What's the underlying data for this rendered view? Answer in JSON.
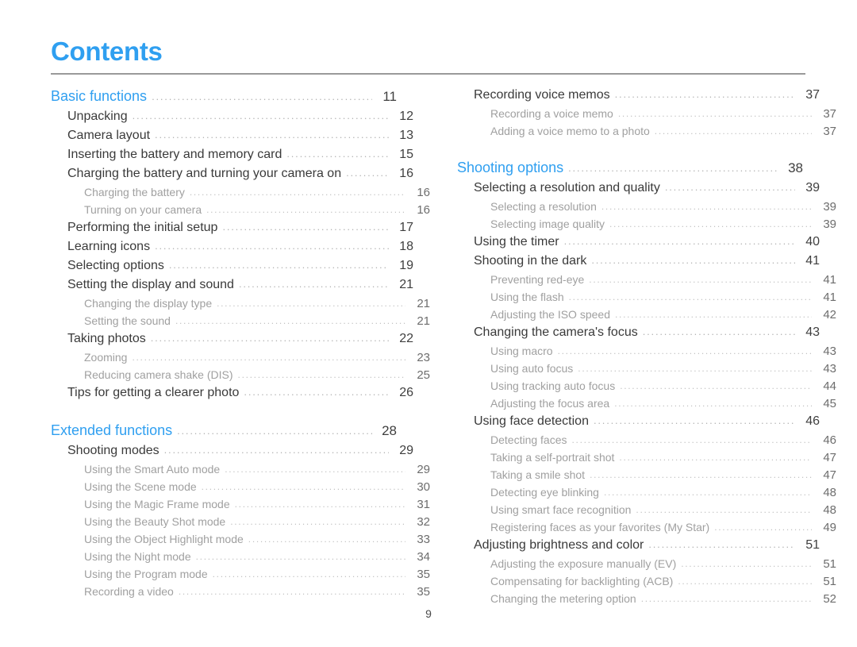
{
  "document": {
    "title": "Contents",
    "folio": "9",
    "accent_color": "#2f9ff0",
    "rule_color": "#9a9a9a"
  },
  "columns": {
    "left": {
      "groups": [
        {
          "entries": [
            {
              "level": 1,
              "label": "Basic functions",
              "page": "11"
            },
            {
              "level": 2,
              "label": "Unpacking",
              "page": "12"
            },
            {
              "level": 2,
              "label": "Camera layout",
              "page": "13"
            },
            {
              "level": 2,
              "label": "Inserting the battery and memory card",
              "page": "15"
            },
            {
              "level": 2,
              "label": "Charging the battery and turning your camera on",
              "page": "16"
            },
            {
              "level": 3,
              "label": "Charging the battery",
              "page": "16"
            },
            {
              "level": 3,
              "label": "Turning on your camera",
              "page": "16"
            },
            {
              "level": 2,
              "label": "Performing the initial setup",
              "page": "17"
            },
            {
              "level": 2,
              "label": "Learning icons",
              "page": "18"
            },
            {
              "level": 2,
              "label": "Selecting options",
              "page": "19"
            },
            {
              "level": 2,
              "label": "Setting the display and sound",
              "page": "21"
            },
            {
              "level": 3,
              "label": "Changing the display type",
              "page": "21"
            },
            {
              "level": 3,
              "label": "Setting the sound",
              "page": "21"
            },
            {
              "level": 2,
              "label": "Taking photos",
              "page": "22"
            },
            {
              "level": 3,
              "label": "Zooming",
              "page": "23"
            },
            {
              "level": 3,
              "label": "Reducing camera shake (DIS)",
              "page": "25"
            },
            {
              "level": 2,
              "label": "Tips for getting a clearer photo",
              "page": "26"
            }
          ]
        },
        {
          "entries": [
            {
              "level": 1,
              "label": "Extended functions",
              "page": "28"
            },
            {
              "level": 2,
              "label": "Shooting modes",
              "page": "29"
            },
            {
              "level": 3,
              "label": "Using the Smart Auto mode",
              "page": "29"
            },
            {
              "level": 3,
              "label": "Using the Scene mode",
              "page": "30"
            },
            {
              "level": 3,
              "label": "Using the Magic Frame mode",
              "page": "31"
            },
            {
              "level": 3,
              "label": "Using the Beauty Shot mode",
              "page": "32"
            },
            {
              "level": 3,
              "label": "Using the Object Highlight mode",
              "page": "33"
            },
            {
              "level": 3,
              "label": "Using the Night mode",
              "page": "34"
            },
            {
              "level": 3,
              "label": "Using the Program mode",
              "page": "35"
            },
            {
              "level": 3,
              "label": "Recording a video",
              "page": "35"
            }
          ]
        }
      ]
    },
    "right": {
      "groups": [
        {
          "entries": [
            {
              "level": 2,
              "label": "Recording voice memos",
              "page": "37"
            },
            {
              "level": 3,
              "label": "Recording a voice memo",
              "page": "37"
            },
            {
              "level": 3,
              "label": "Adding a voice memo to a photo",
              "page": "37"
            }
          ]
        },
        {
          "entries": [
            {
              "level": 1,
              "label": "Shooting options",
              "page": "38"
            },
            {
              "level": 2,
              "label": "Selecting a resolution and quality",
              "page": "39"
            },
            {
              "level": 3,
              "label": "Selecting a resolution",
              "page": "39"
            },
            {
              "level": 3,
              "label": "Selecting image quality",
              "page": "39"
            },
            {
              "level": 2,
              "label": "Using the timer",
              "page": "40"
            },
            {
              "level": 2,
              "label": "Shooting in the dark",
              "page": "41"
            },
            {
              "level": 3,
              "label": "Preventing red-eye",
              "page": "41"
            },
            {
              "level": 3,
              "label": "Using the flash",
              "page": "41"
            },
            {
              "level": 3,
              "label": "Adjusting the ISO speed",
              "page": "42"
            },
            {
              "level": 2,
              "label": "Changing the camera's focus",
              "page": "43"
            },
            {
              "level": 3,
              "label": "Using macro",
              "page": "43"
            },
            {
              "level": 3,
              "label": "Using auto focus",
              "page": "43"
            },
            {
              "level": 3,
              "label": "Using tracking auto focus",
              "page": "44"
            },
            {
              "level": 3,
              "label": "Adjusting the focus area",
              "page": "45"
            },
            {
              "level": 2,
              "label": "Using face detection",
              "page": "46"
            },
            {
              "level": 3,
              "label": "Detecting faces",
              "page": "46"
            },
            {
              "level": 3,
              "label": "Taking a self-portrait shot",
              "page": "47"
            },
            {
              "level": 3,
              "label": "Taking a smile shot",
              "page": "47"
            },
            {
              "level": 3,
              "label": "Detecting eye blinking",
              "page": "48"
            },
            {
              "level": 3,
              "label": "Using smart face recognition",
              "page": "48"
            },
            {
              "level": 3,
              "label": "Registering faces as your favorites (My Star)",
              "page": "49"
            },
            {
              "level": 2,
              "label": "Adjusting brightness and color",
              "page": "51"
            },
            {
              "level": 3,
              "label": "Adjusting the exposure manually (EV)",
              "page": "51"
            },
            {
              "level": 3,
              "label": "Compensating for backlighting (ACB)",
              "page": "51"
            },
            {
              "level": 3,
              "label": "Changing the metering option",
              "page": "52"
            }
          ]
        }
      ]
    }
  }
}
